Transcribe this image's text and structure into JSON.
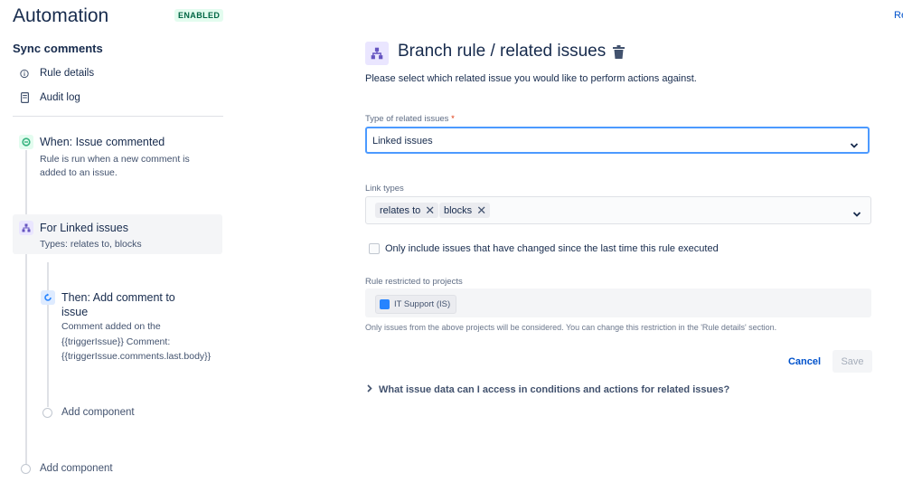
{
  "app": {
    "title": "Automation",
    "status_badge": "ENABLED",
    "edge_text": "Re"
  },
  "sidebar": {
    "rule_name": "Sync comments",
    "nav": [
      {
        "label": "Rule details",
        "icon": "info-icon"
      },
      {
        "label": "Audit log",
        "icon": "document-icon"
      }
    ],
    "trigger": {
      "title": "When: Issue commented",
      "description": "Rule is run when a new comment is added to an issue.",
      "icon": "comment-icon",
      "color": "#36b37e"
    },
    "branch": {
      "title": "For Linked issues",
      "description": "Types: relates to, blocks",
      "icon": "branch-icon",
      "color": "#6554c0"
    },
    "action": {
      "title_line1": "Then: Add comment to",
      "title_line2": "issue",
      "description_line1": "Comment added on the",
      "description_line2": "{{triggerIssue}} Comment:",
      "description_line3": "{{triggerIssue.comments.last.body}}",
      "icon": "refresh-icon",
      "color": "#2684ff"
    },
    "add_component_inner": "Add component",
    "add_component_outer": "Add component"
  },
  "panel": {
    "title": "Branch rule / related issues",
    "description": "Please select which related issue you would like to perform actions against.",
    "related_type": {
      "label": "Type of related issues",
      "required_marker": "*",
      "value": "Linked issues"
    },
    "link_types": {
      "label": "Link types",
      "tags": [
        "relates to",
        "blocks"
      ]
    },
    "checkbox": {
      "label": "Only include issues that have changed since the last time this rule executed",
      "checked": false
    },
    "projects": {
      "label": "Rule restricted to projects",
      "chip": "IT Support (IS)",
      "helper": "Only issues from the above projects will be considered. You can change this restriction in the 'Rule details' section."
    },
    "buttons": {
      "cancel": "Cancel",
      "save": "Save"
    },
    "expander": "What issue data can I access in conditions and actions for related issues?"
  }
}
